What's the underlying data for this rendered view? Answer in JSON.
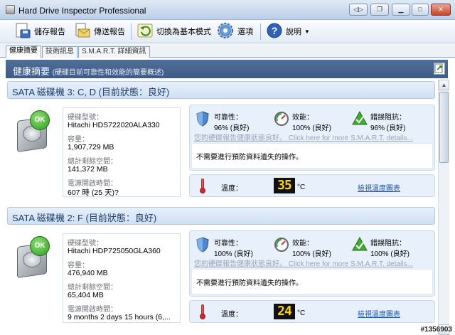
{
  "window": {
    "title": "Hard Drive Inspector Professional"
  },
  "toolbar": {
    "save_report": "儲存報告",
    "send_report": "傳送報告",
    "switch_mode": "切換為基本模式",
    "options": "選項",
    "help": "說明"
  },
  "tabs": [
    "健康摘要",
    "技術訊息",
    "S.M.A.R.T. 詳細資訊"
  ],
  "summary": {
    "title": "健康摘要",
    "subtitle": "(硬碟目前可靠性和效能的簡要概述)"
  },
  "labels": {
    "model": "硬碟型號：",
    "capacity": "容量：",
    "free_space": "總計剩餘空間：",
    "power_on": "電源開啟時間：",
    "reliability": "可靠性：",
    "performance": "效能：",
    "error_resistance": "錯誤阻抗：",
    "temperature": "溫度：",
    "unit_c": "°C",
    "temp_history_link": "檢視溫度圖表",
    "smart_link": "您的硬碟報告健康狀態良好。 Click here for more S.M.A.R.T. details...",
    "ok_badge": "OK"
  },
  "disks": [
    {
      "title": "SATA 磁碟機 3: C, D (目前狀態：良好)",
      "model": "Hitachi HDS722020ALA330",
      "capacity": "1,907,729 MB",
      "free_space": "141,372 MB",
      "power_on": "607 時 (25 天)?",
      "reliability": "96% (良好)",
      "performance": "100% (良好)",
      "error_resistance": "96% (良好)",
      "action": "不需要進行預防資料遺失的操作。",
      "temperature": "35"
    },
    {
      "title": "SATA 磁碟機 2: F (目前狀態：良好)",
      "model": "Hitachi HDP725050GLA360",
      "capacity": "476,940 MB",
      "free_space": "65,404 MB",
      "power_on": "9 months 2 days 15 hours (6,...",
      "reliability": "100% (良好)",
      "performance": "100% (良好)",
      "error_resistance": "100% (良好)",
      "action": "不需要進行預防資料遺失的操作。",
      "temperature": "24"
    }
  ],
  "watermark": "#1356903",
  "colors": {
    "header": "#46658f",
    "ok_green": "#2f9a1c",
    "lcd_digits": "#ffd400",
    "panel_bg": "#e7f0fb"
  }
}
